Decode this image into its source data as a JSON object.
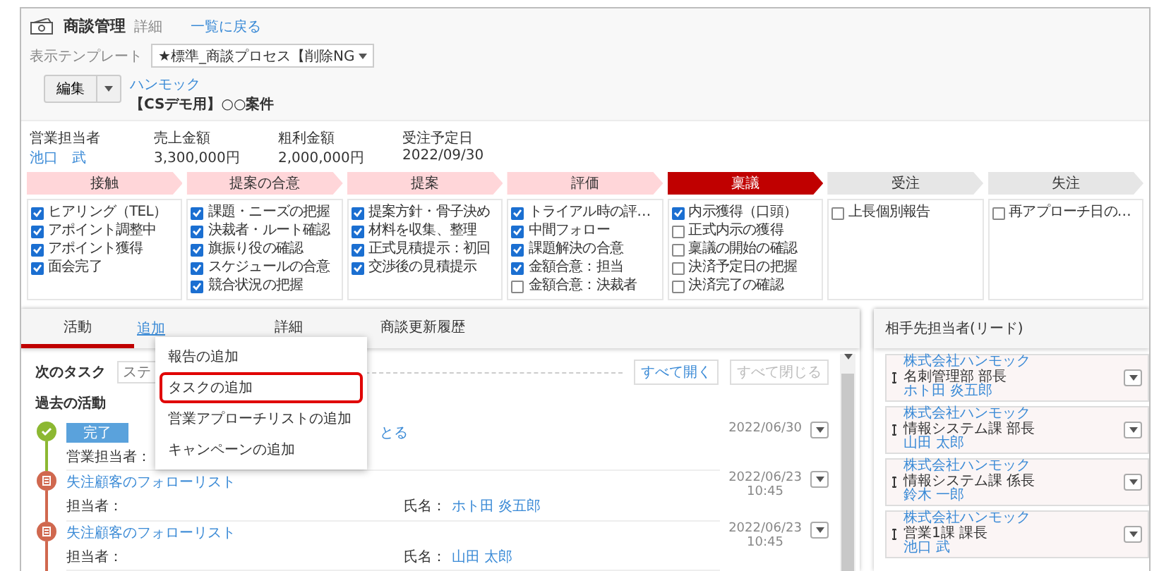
{
  "header": {
    "title": "商談管理",
    "subtitle": "詳細",
    "back_link": "一覧に戻る"
  },
  "template": {
    "label": "表示テンプレート",
    "value": "★標準_商談プロセス【削除NG"
  },
  "edit_button": "編集",
  "deal": {
    "company": "ハンモック",
    "name": "【CSデモ用】○○案件"
  },
  "summary": [
    {
      "label": "営業担当者",
      "value": "池口　武",
      "link": true
    },
    {
      "label": "売上金額",
      "value": "3,300,000円",
      "link": false
    },
    {
      "label": "粗利金額",
      "value": "2,000,000円",
      "link": false
    },
    {
      "label": "受注予定日",
      "value": "2022/09/30",
      "link": false
    }
  ],
  "stages": [
    {
      "label": "接触",
      "completed": true,
      "current": false,
      "tasks": [
        {
          "label": "ヒアリング（TEL）",
          "checked": true
        },
        {
          "label": "アポイント調整中",
          "checked": true
        },
        {
          "label": "アポイント獲得",
          "checked": true
        },
        {
          "label": "面会完了",
          "checked": true
        }
      ]
    },
    {
      "label": "提案の合意",
      "completed": true,
      "current": false,
      "tasks": [
        {
          "label": "課題・ニーズの把握",
          "checked": true
        },
        {
          "label": "決裁者・ルート確認",
          "checked": true
        },
        {
          "label": "旗振り役の確認",
          "checked": true
        },
        {
          "label": "スケジュールの合意",
          "checked": true
        },
        {
          "label": "競合状況の把握",
          "checked": true
        }
      ]
    },
    {
      "label": "提案",
      "completed": true,
      "current": false,
      "tasks": [
        {
          "label": "提案方針・骨子決め",
          "checked": true
        },
        {
          "label": "材料を収集、整理",
          "checked": true
        },
        {
          "label": "正式見積提示：初回",
          "checked": true
        },
        {
          "label": "交渉後の見積提示",
          "checked": true
        }
      ]
    },
    {
      "label": "評価",
      "completed": true,
      "current": false,
      "tasks": [
        {
          "label": "トライアル時の評…",
          "checked": true
        },
        {
          "label": "中間フォロー",
          "checked": true
        },
        {
          "label": "課題解決の合意",
          "checked": true
        },
        {
          "label": "金額合意：担当",
          "checked": true
        },
        {
          "label": "金額合意：決裁者",
          "checked": false
        }
      ]
    },
    {
      "label": "稟議",
      "completed": false,
      "current": true,
      "tasks": [
        {
          "label": "内示獲得（口頭）",
          "checked": true
        },
        {
          "label": "正式内示の獲得",
          "checked": false
        },
        {
          "label": "稟議の開始の確認",
          "checked": false
        },
        {
          "label": "決済予定日の把握",
          "checked": false
        },
        {
          "label": "決済完了の確認",
          "checked": false
        }
      ]
    },
    {
      "label": "受注",
      "completed": false,
      "current": false,
      "tasks": [
        {
          "label": "上長個別報告",
          "checked": false
        }
      ]
    },
    {
      "label": "失注",
      "completed": false,
      "current": false,
      "tasks": [
        {
          "label": "再アプローチ日の…",
          "checked": false
        }
      ]
    }
  ],
  "tabs": [
    {
      "label": "活動",
      "selected": true
    },
    {
      "label": "詳細",
      "selected": false
    },
    {
      "label": "商談更新履歴",
      "selected": false
    }
  ],
  "add_link": "追加",
  "add_menu": [
    {
      "label": "報告の追加",
      "highlighted": false
    },
    {
      "label": "タスクの追加",
      "highlighted": true
    },
    {
      "label": "営業アプローチリストの追加",
      "highlighted": false
    },
    {
      "label": "キャンペーンの追加",
      "highlighted": false
    }
  ],
  "next_task": {
    "label": "次のタスク",
    "placeholder": "ステ"
  },
  "expand_all": {
    "label": "すべて開く",
    "disabled": false
  },
  "collapse_all": {
    "label": "すべて閉じる",
    "disabled": true
  },
  "past_label": "過去の活動",
  "activities": [
    {
      "kind": "task",
      "badge": "完了",
      "title": "とる",
      "owner_label": "営業担当者：",
      "date": "2022/06/30"
    },
    {
      "kind": "list",
      "title": "失注顧客のフォローリスト",
      "owner_label": "担当者：",
      "name_label": "氏名：",
      "name": "ホト田 炎五郎",
      "date": "2022/06/23",
      "time": "10:45"
    },
    {
      "kind": "list",
      "title": "失注顧客のフォローリスト",
      "owner_label": "担当者：",
      "name_label": "氏名：",
      "name": "山田 太郎",
      "date": "2022/06/23",
      "time": "10:45"
    }
  ],
  "contacts": {
    "title": "相手先担当者(リード)",
    "items": [
      {
        "company": "株式会社ハンモック",
        "position": "名刺管理部 部長",
        "name": "ホト田 炎五郎"
      },
      {
        "company": "株式会社ハンモック",
        "position": "情報システム課 部長",
        "name": "山田 太郎"
      },
      {
        "company": "株式会社ハンモック",
        "position": "情報システム課 係長",
        "name": "鈴木 一郎"
      },
      {
        "company": "株式会社ハンモック",
        "position": "営業1課 課長",
        "name": "池口 武"
      }
    ]
  }
}
